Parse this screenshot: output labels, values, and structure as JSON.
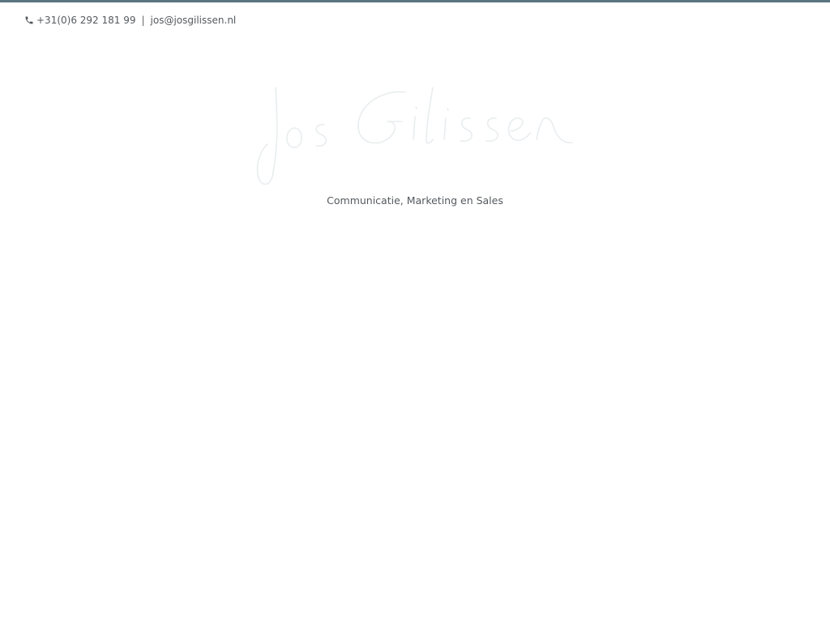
{
  "header": {
    "phone": "+31(0)6 292 181 99",
    "separator": "|",
    "email": "jos@josgilissen.nl",
    "icon": "phone-icon"
  },
  "logo": {
    "signature_text": "Jos Gilissen"
  },
  "tagline": "Communicatie, Marketing en Sales",
  "colors": {
    "accent_bar": "#5b7580",
    "text": "#555a5e",
    "signature": "#e8ecee"
  }
}
